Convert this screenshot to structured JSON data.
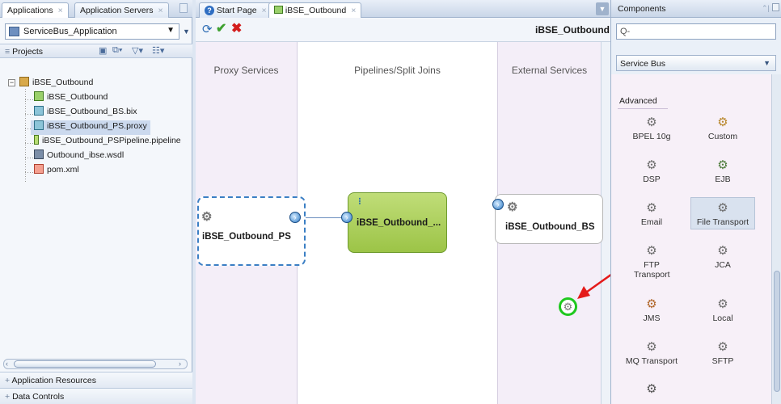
{
  "left": {
    "tabs": [
      "Applications",
      "Application Servers"
    ],
    "app_combo": "ServiceBus_Application",
    "projects_label": "Projects",
    "tree": [
      {
        "label": "iBSE_Outbound"
      },
      {
        "label": "iBSE_Outbound"
      },
      {
        "label": "iBSE_Outbound_BS.bix"
      },
      {
        "label": "iBSE_Outbound_PS.proxy"
      },
      {
        "label": "iBSE_Outbound_PSPipeline.pipeline"
      },
      {
        "label": "Outbound_ibse.wsdl"
      },
      {
        "label": "pom.xml"
      }
    ],
    "application_resources": "Application Resources",
    "data_controls": "Data Controls"
  },
  "editor": {
    "tabs": [
      "Start Page",
      "iBSE_Outbound"
    ],
    "title": "iBSE_Outbound",
    "lanes": [
      "Proxy Services",
      "Pipelines/Split Joins",
      "External Services"
    ],
    "proxy_node": "iBSE_Outbound_PS",
    "pipeline_node": "iBSE_Outbound_...",
    "business_node": "iBSE_Outbound_BS"
  },
  "components": {
    "title": "Components",
    "search_placeholder": "Q-",
    "category": "Service Bus",
    "section": "Advanced",
    "items": [
      {
        "label": "BPEL 10g"
      },
      {
        "label": "Custom"
      },
      {
        "label": "DSP"
      },
      {
        "label": "EJB"
      },
      {
        "label": "Email"
      },
      {
        "label": "File Transport"
      },
      {
        "label": "FTP Transport"
      },
      {
        "label": "JCA"
      },
      {
        "label": "JMS"
      },
      {
        "label": "Local"
      },
      {
        "label": "MQ Transport"
      },
      {
        "label": "SFTP"
      }
    ]
  },
  "colors": {
    "pipeline_fill": "#a6cc4e",
    "drop_target_ring": "#1ec81e",
    "annotation_arrow": "#e41a1a"
  }
}
